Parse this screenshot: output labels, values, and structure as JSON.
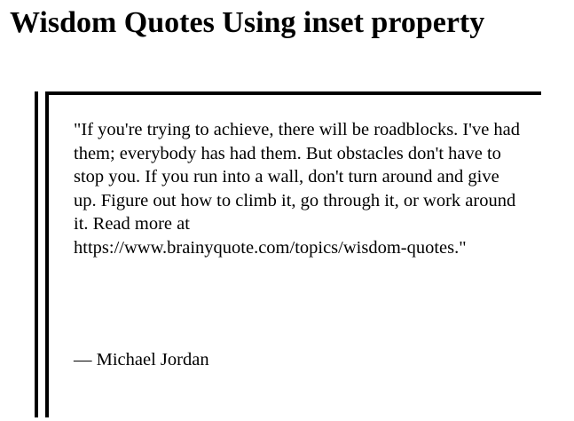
{
  "header": {
    "title": "Wisdom Quotes Using inset property"
  },
  "quote": {
    "text": "\"If you're trying to achieve, there will be roadblocks. I've had them; everybody has had them. But obstacles don't have to stop you. If you run into a wall, don't turn around and give up. Figure out how to climb it, go through it, or work around it. Read more at https://www.brainyquote.com/topics/wisdom-quotes.\"",
    "author": "— Michael Jordan"
  },
  "colors": {
    "text": "#000000",
    "background": "#ffffff",
    "border": "#000000"
  }
}
